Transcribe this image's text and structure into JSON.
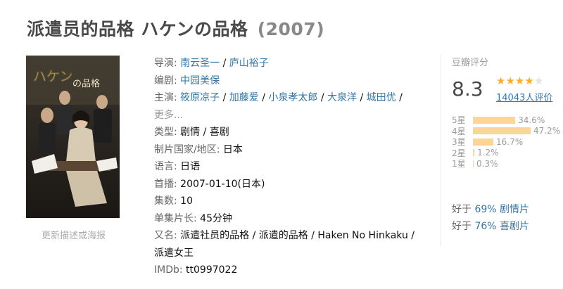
{
  "title": {
    "main": "派遣员的品格 ハケンの品格",
    "year": "(2007)"
  },
  "poster": {
    "title_text": "ハケンの品格",
    "link_label": "更新描述或海报"
  },
  "info": {
    "director": {
      "key": "导演",
      "values": [
        "南云圣一",
        "庐山裕子"
      ]
    },
    "writer": {
      "key": "编剧",
      "values": [
        "中园美保"
      ]
    },
    "cast": {
      "key": "主演",
      "values": [
        "筱原凉子",
        "加藤爱",
        "小泉孝太郎",
        "大泉洋",
        "城田优"
      ],
      "more": "更多..."
    },
    "genre": {
      "key": "类型",
      "value": "剧情 / 喜剧"
    },
    "country": {
      "key": "制片国家/地区",
      "value": "日本"
    },
    "language": {
      "key": "语言",
      "value": "日语"
    },
    "premiere": {
      "key": "首播",
      "value": "2007-01-10(日本)"
    },
    "episodes": {
      "key": "集数",
      "value": "10"
    },
    "runtime": {
      "key": "单集片长",
      "value": "45分钟"
    },
    "aka": {
      "key": "又名",
      "line1": "派遣社员的品格 / 派遣的品格 / Haken No Hinkaku /",
      "line2": "派遣女王"
    },
    "imdb": {
      "key": "IMDb",
      "value": "tt0997022"
    }
  },
  "rating": {
    "header": "豆瓣评分",
    "score": "8.3",
    "stars": 4,
    "people": "14043人评价",
    "distribution": [
      {
        "label": "5星",
        "pct": "34.6%",
        "value": 34.6
      },
      {
        "label": "4星",
        "pct": "47.2%",
        "value": 47.2
      },
      {
        "label": "3星",
        "pct": "16.7%",
        "value": 16.7
      },
      {
        "label": "2星",
        "pct": "1.2%",
        "value": 1.2
      },
      {
        "label": "1星",
        "pct": "0.3%",
        "value": 0.3
      }
    ],
    "better_than": [
      {
        "prefix": "好于",
        "pct": "69%",
        "genre": "剧情片"
      },
      {
        "prefix": "好于",
        "pct": "76%",
        "genre": "喜剧片"
      }
    ]
  },
  "colors": {
    "link": "#3377aa",
    "star_on": "#ffac2d",
    "bar": "#ffd596"
  }
}
